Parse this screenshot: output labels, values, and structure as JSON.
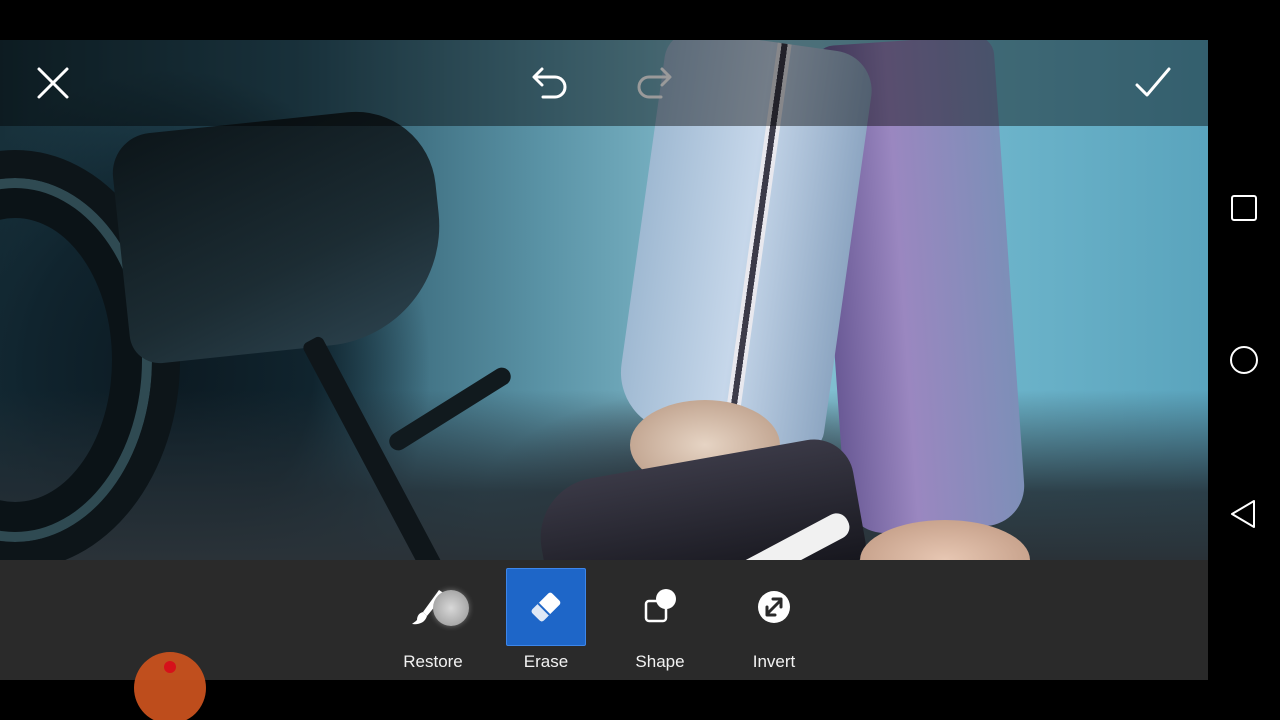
{
  "toolbar": {
    "close_icon": "close-icon",
    "undo_icon": "undo-icon",
    "redo_icon": "redo-icon",
    "done_icon": "checkmark-icon"
  },
  "tools": [
    {
      "label": "Restore",
      "icon": "brush-icon",
      "selected": false
    },
    {
      "label": "Erase",
      "icon": "eraser-icon",
      "selected": true
    },
    {
      "label": "Shape",
      "icon": "shape-icon",
      "selected": false
    },
    {
      "label": "Invert",
      "icon": "invert-icon",
      "selected": false
    }
  ],
  "colors": {
    "selected_tool": "#1e66c8",
    "bottom_bar": "#2a2a2a",
    "recording_dot": "#e0101a"
  },
  "nav": {
    "recents_icon": "square-icon",
    "home_icon": "circle-icon",
    "back_icon": "triangle-back-icon"
  }
}
